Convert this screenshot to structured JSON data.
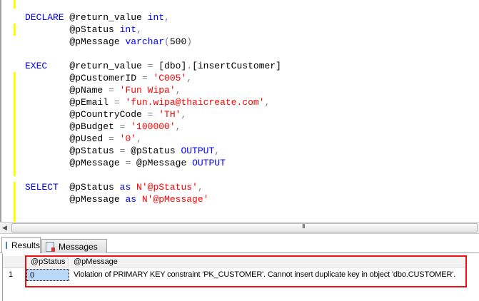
{
  "editor": {
    "lines": [
      [
        {
          "t": "DECLARE ",
          "c": "kw"
        },
        {
          "t": "@return_value ",
          "c": "tx"
        },
        {
          "t": "int",
          "c": "kw"
        },
        {
          "t": ",",
          "c": "op"
        }
      ],
      [
        {
          "t": "        @pStatus ",
          "c": "tx"
        },
        {
          "t": "int",
          "c": "kw"
        },
        {
          "t": ",",
          "c": "op"
        }
      ],
      [
        {
          "t": "        @pMessage ",
          "c": "tx"
        },
        {
          "t": "varchar",
          "c": "kw"
        },
        {
          "t": "(",
          "c": "op"
        },
        {
          "t": "500",
          "c": "tx"
        },
        {
          "t": ")",
          "c": "op"
        }
      ],
      [],
      [
        {
          "t": "EXEC    ",
          "c": "kw"
        },
        {
          "t": "@return_value ",
          "c": "tx"
        },
        {
          "t": "=",
          "c": "op"
        },
        {
          "t": " [dbo]",
          "c": "tx"
        },
        {
          "t": ".",
          "c": "op"
        },
        {
          "t": "[insertCustomer]",
          "c": "tx"
        }
      ],
      [
        {
          "t": "        @pCustomerID ",
          "c": "tx"
        },
        {
          "t": "=",
          "c": "op"
        },
        {
          "t": " 'C005'",
          "c": "st"
        },
        {
          "t": ",",
          "c": "op"
        }
      ],
      [
        {
          "t": "        @pName ",
          "c": "tx"
        },
        {
          "t": "=",
          "c": "op"
        },
        {
          "t": " 'Fun Wipa'",
          "c": "st"
        },
        {
          "t": ",",
          "c": "op"
        }
      ],
      [
        {
          "t": "        @pEmail ",
          "c": "tx"
        },
        {
          "t": "=",
          "c": "op"
        },
        {
          "t": " 'fun.wipa@thaicreate.com'",
          "c": "st"
        },
        {
          "t": ",",
          "c": "op"
        }
      ],
      [
        {
          "t": "        @pCountryCode ",
          "c": "tx"
        },
        {
          "t": "=",
          "c": "op"
        },
        {
          "t": " 'TH'",
          "c": "st"
        },
        {
          "t": ",",
          "c": "op"
        }
      ],
      [
        {
          "t": "        @pBudget ",
          "c": "tx"
        },
        {
          "t": "=",
          "c": "op"
        },
        {
          "t": " '100000'",
          "c": "st"
        },
        {
          "t": ",",
          "c": "op"
        }
      ],
      [
        {
          "t": "        @pUsed ",
          "c": "tx"
        },
        {
          "t": "=",
          "c": "op"
        },
        {
          "t": " '0'",
          "c": "st"
        },
        {
          "t": ",",
          "c": "op"
        }
      ],
      [
        {
          "t": "        @pStatus ",
          "c": "tx"
        },
        {
          "t": "=",
          "c": "op"
        },
        {
          "t": " @pStatus ",
          "c": "tx"
        },
        {
          "t": "OUTPUT",
          "c": "kw"
        },
        {
          "t": ",",
          "c": "op"
        }
      ],
      [
        {
          "t": "        @pMessage ",
          "c": "tx"
        },
        {
          "t": "=",
          "c": "op"
        },
        {
          "t": " @pMessage ",
          "c": "tx"
        },
        {
          "t": "OUTPUT",
          "c": "kw"
        }
      ],
      [],
      [
        {
          "t": "SELECT  ",
          "c": "kw"
        },
        {
          "t": "@pStatus ",
          "c": "tx"
        },
        {
          "t": "as",
          "c": "kw"
        },
        {
          "t": " N'@pStatus'",
          "c": "st"
        },
        {
          "t": ",",
          "c": "op"
        }
      ],
      [
        {
          "t": "        @pMessage ",
          "c": "tx"
        },
        {
          "t": "as",
          "c": "kw"
        },
        {
          "t": " N'@pMessage'",
          "c": "st"
        }
      ]
    ]
  },
  "tabs": {
    "results": "Results",
    "messages": "Messages"
  },
  "grid": {
    "columns": [
      "@pStatus",
      "@pMessage"
    ],
    "rows": [
      {
        "num": "1",
        "pStatus": "0",
        "pMessage": "Violation of PRIMARY KEY constraint 'PK_CUSTOMER'. Cannot insert duplicate key in object 'dbo.CUSTOMER'."
      }
    ]
  },
  "colors": {
    "keyword": "#0000ff",
    "string": "#ff0000",
    "highlight": "#ee1111"
  }
}
